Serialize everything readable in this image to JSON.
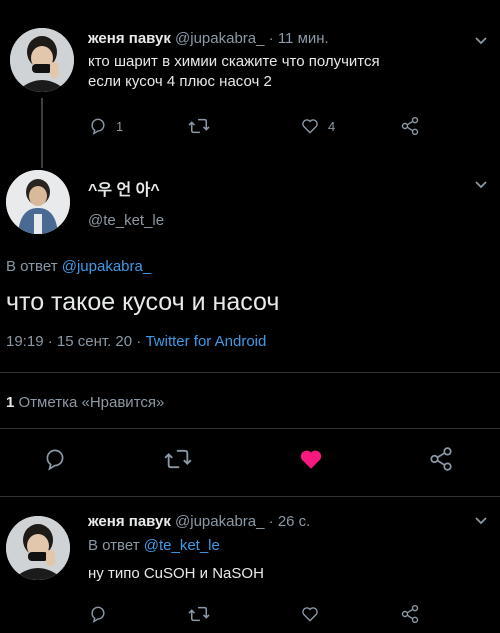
{
  "tweet1": {
    "name": "женя павук",
    "handle": "@jupakabra_",
    "sep": "·",
    "time": "11 мин.",
    "text_line1": "кто шарит в химии скажите что получится",
    "text_line2": "если кусоч 4 плюс насоч 2",
    "reply_count": "1",
    "like_count": "4"
  },
  "main_tweet": {
    "name": "^우 언 아^",
    "handle": "@te_ket_le",
    "reply_to_prefix": "В ответ",
    "reply_to_handle": "@jupakabra_",
    "text": "что такое кусоч и насоч",
    "time": "19:19",
    "sep1": "·",
    "date": "15 сент. 20",
    "sep2": "·",
    "source": "Twitter for Android",
    "likes_count": "1",
    "likes_label": "Отметка «Нравится»"
  },
  "tweet3": {
    "name": "женя павук",
    "handle": "@jupakabra_",
    "sep": "·",
    "time": "26 с.",
    "reply_to_prefix": "В ответ",
    "reply_to_handle": "@te_ket_le",
    "text": "ну типо CuSOH и NaSOH"
  },
  "icons": {
    "reply": "reply-icon",
    "retweet": "retweet-icon",
    "like": "heart-icon",
    "share": "share-icon",
    "more": "chevron-down-icon"
  },
  "colors": {
    "background": "#000000",
    "text": "#e7e9ea",
    "muted": "#8b98a5",
    "link": "#3f9ae6",
    "liked": "#f91880",
    "divider": "#2f3336"
  }
}
